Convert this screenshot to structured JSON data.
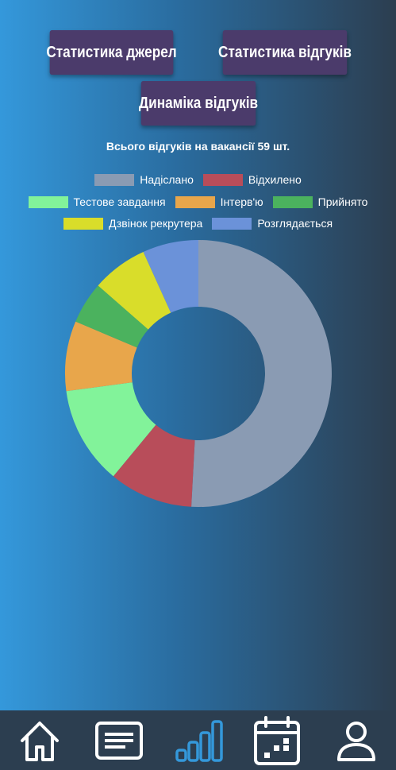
{
  "buttons": {
    "sources": "Статистика джерел",
    "responses": "Статистика відгуків",
    "dynamics": "Динаміка відгуків"
  },
  "total_label": "Всього відгуків на вакансії 59 шт.",
  "chart_data": {
    "type": "doughnut",
    "total": 59,
    "legend_position": "top",
    "categories": [
      "Надіслано",
      "Відхилено",
      "Тестове завдання",
      "Інтерв'ю",
      "Прийнято",
      "Дзвінок рекрутера",
      "Розглядається"
    ],
    "values": [
      30,
      6,
      7,
      5,
      3,
      4,
      4
    ],
    "colors": [
      "#8a9bb3",
      "#b84d5a",
      "#82f39a",
      "#e8a64b",
      "#4bb25e",
      "#d9dd2a",
      "#6b92d9"
    ]
  },
  "nav": {
    "items": [
      "home-icon",
      "list-icon",
      "chart-icon",
      "calendar-icon",
      "profile-icon"
    ],
    "active": "chart-icon",
    "active_color": "#3498db",
    "icon_color": "#ffffff"
  }
}
